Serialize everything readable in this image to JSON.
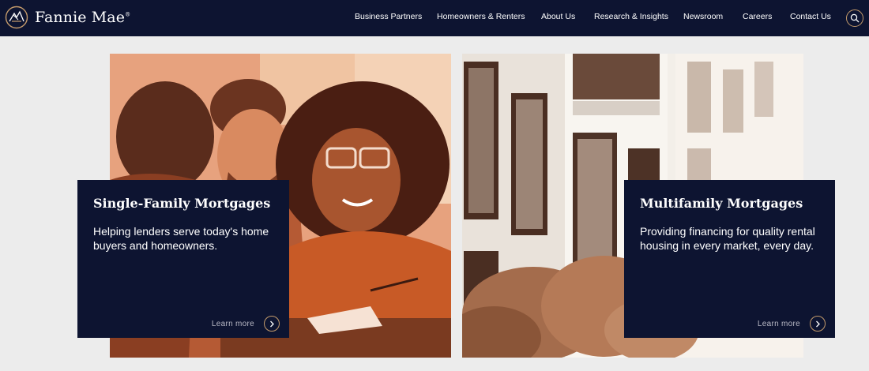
{
  "header": {
    "brand": "Fannie Mae",
    "brand_mark": "®",
    "nav": [
      {
        "label": "Business Partners"
      },
      {
        "label": "Homeowners & Renters"
      },
      {
        "label": "About Us"
      },
      {
        "label": "Research & Insights"
      },
      {
        "label": "Newsroom"
      },
      {
        "label": "Careers"
      },
      {
        "label": "Contact Us"
      }
    ],
    "search_icon": "search-icon"
  },
  "cards": [
    {
      "title": "Single-Family Mortgages",
      "description": "Helping lenders serve today's home buyers and homeowners.",
      "link": "Learn more",
      "image": "people-reviewing-documents-photo"
    },
    {
      "title": "Multifamily Mortgages",
      "description": "Providing financing for quality rental housing in every market, every day.",
      "link": "Learn more",
      "image": "apartment-building-photo"
    }
  ],
  "colors": {
    "navy": "#0d1431",
    "gold": "#c39a6b",
    "page_bg": "#ececec"
  }
}
